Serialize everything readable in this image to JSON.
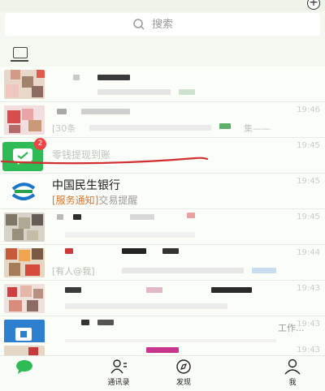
{
  "header": {
    "plus_symbol": "+"
  },
  "search": {
    "placeholder": "搜索"
  },
  "chats": [
    {
      "time": ""
    },
    {
      "time": "19:46",
      "preview_left": "[30条",
      "preview_right": "集——"
    },
    {
      "time": "19:45",
      "preview": "零钱提现到账",
      "badge": "2"
    },
    {
      "time": "19:45",
      "name": "中国民生银行",
      "tag": "[服务通知]",
      "preview": "交易提醒"
    },
    {
      "time": "19:45"
    },
    {
      "time": "19:44",
      "preview": "[有人@我]"
    },
    {
      "time": "19:43"
    },
    {
      "time": "19:43",
      "preview_right": "工作..."
    },
    {
      "time": "19:43"
    }
  ],
  "tabbar": {
    "contacts": "通讯录",
    "discover": "发现",
    "me": "我"
  },
  "colors": {
    "wechat_green": "#2ebb55",
    "badge_red": "#f04444",
    "tag_orange": "#d9752c"
  }
}
